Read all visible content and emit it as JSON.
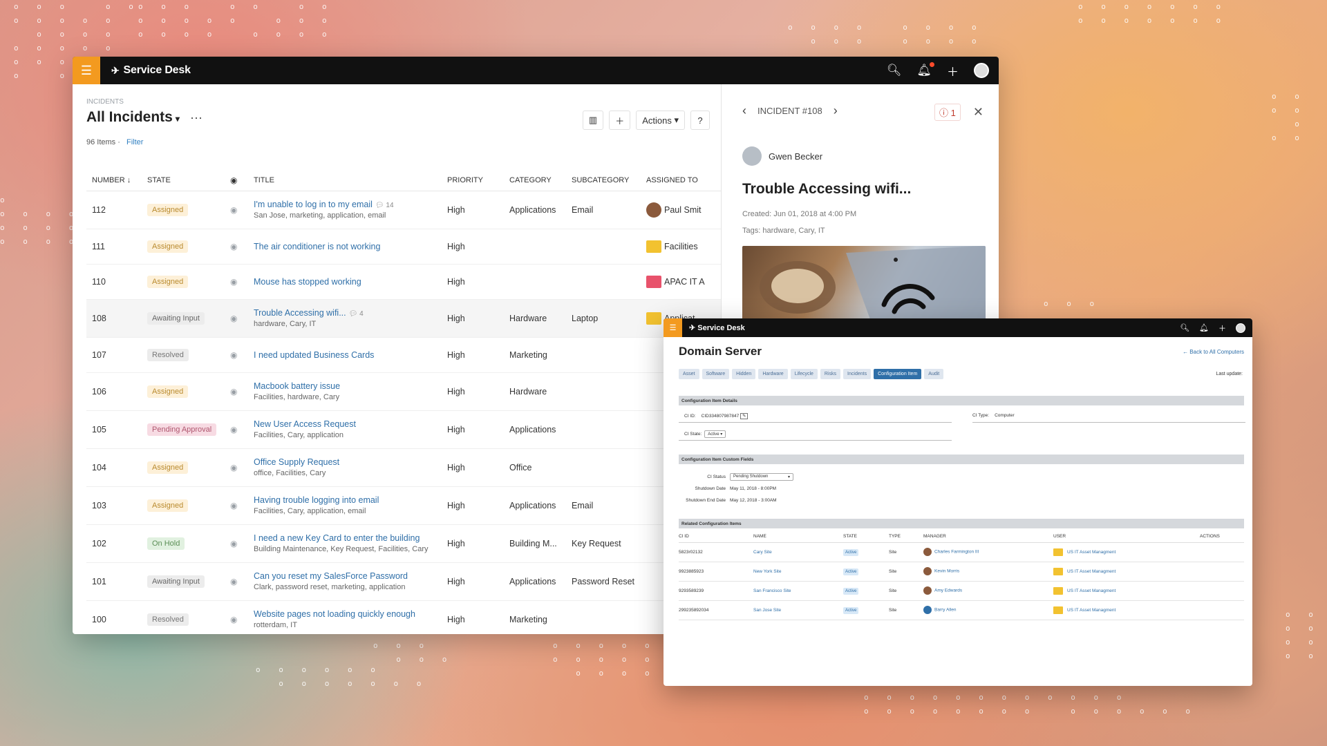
{
  "app": {
    "name": "Service Desk"
  },
  "list": {
    "breadcrumb": "INCIDENTS",
    "title": "All Incidents",
    "count": "96 Items",
    "filter": "Filter",
    "actions_label": "Actions",
    "help": "?",
    "columns": [
      "NUMBER",
      "STATE",
      "TITLE",
      "PRIORITY",
      "CATEGORY",
      "SUBCATEGORY",
      "ASSIGNED TO"
    ],
    "rows": [
      {
        "number": "112",
        "state": "Assigned",
        "title": "I'm unable to log in to my email",
        "comments": "14",
        "tags": "San Jose, marketing, application, email",
        "priority": "High",
        "category": "Applications",
        "subcategory": "Email",
        "assigned": "Paul Smit"
      },
      {
        "number": "111",
        "state": "Assigned",
        "title": "The air conditioner is not working",
        "priority": "High",
        "category": "",
        "subcategory": "",
        "assigned": "Facilities"
      },
      {
        "number": "110",
        "state": "Assigned",
        "title": "Mouse has stopped working",
        "priority": "High",
        "category": "",
        "subcategory": "",
        "assigned": "APAC IT A"
      },
      {
        "number": "108",
        "state": "Awaiting Input",
        "title": "Trouble Accessing wifi...",
        "comments": "4",
        "tags": "hardware, Cary, IT",
        "priority": "High",
        "category": "Hardware",
        "subcategory": "Laptop",
        "assigned": "Applicat"
      },
      {
        "number": "107",
        "state": "Resolved",
        "title": "I need updated Business Cards",
        "priority": "High",
        "category": "Marketing",
        "subcategory": "",
        "assigned": ""
      },
      {
        "number": "106",
        "state": "Assigned",
        "title": "Macbook battery issue",
        "tags": "Facilities, hardware, Cary",
        "priority": "High",
        "category": "Hardware",
        "subcategory": "",
        "assigned": ""
      },
      {
        "number": "105",
        "state": "Pending Approval",
        "title": "New User Access Request",
        "tags": "Facilities, Cary, application",
        "priority": "High",
        "category": "Applications",
        "subcategory": "",
        "assigned": ""
      },
      {
        "number": "104",
        "state": "Assigned",
        "title": "Office Supply Request",
        "tags": "office, Facilities, Cary",
        "priority": "High",
        "category": "Office",
        "subcategory": "",
        "assigned": ""
      },
      {
        "number": "103",
        "state": "Assigned",
        "title": "Having trouble logging into email",
        "tags": "Facilities, Cary, application, email",
        "priority": "High",
        "category": "Applications",
        "subcategory": "Email",
        "assigned": ""
      },
      {
        "number": "102",
        "state": "On Hold",
        "title": "I need a new Key Card to enter the building",
        "tags": "Building Maintenance, Key Request, Facilities, Cary",
        "priority": "High",
        "category": "Building M...",
        "subcategory": "Key Request",
        "assigned": ""
      },
      {
        "number": "101",
        "state": "Awaiting Input",
        "title": "Can you reset my SalesForce Password",
        "tags": "Clark, password reset, marketing, application",
        "priority": "High",
        "category": "Applications",
        "subcategory": "Password Reset",
        "assigned": ""
      },
      {
        "number": "100",
        "state": "Resolved",
        "title": "Website pages not loading quickly enough",
        "tags": "rotterdam, IT",
        "priority": "High",
        "category": "Marketing",
        "subcategory": "",
        "assigned": ""
      }
    ]
  },
  "detail": {
    "incident": "INCIDENT #108",
    "alert_count": "1",
    "person": "Gwen Becker",
    "title": "Trouble Accessing wifi...",
    "created": "Created: Jun 01, 2018 at 4:00 PM",
    "tags": "Tags: hardware, Cary, IT"
  },
  "domain": {
    "app_name": "Service Desk",
    "title": "Domain Server",
    "back": "← Back to All Computers",
    "last_update": "Last update:",
    "tabs": [
      "Asset",
      "Software",
      "Hidden",
      "Hardware",
      "Lifecycle",
      "Risks",
      "Incidents",
      "Configuration Item",
      "Audit"
    ],
    "sec_details": "Configuration Item Details",
    "ci_id_label": "CI ID:",
    "ci_id_value": "CID334807987847",
    "ci_type_label": "CI Type:",
    "ci_type_value": "Computer",
    "ci_state_label": "CI State:",
    "ci_state_value": "Active",
    "sec_custom": "Configuration Item Custom Fields",
    "ci_status_label": "CI Status",
    "ci_status_value": "Pending Shutdown",
    "shutdown_date_label": "Shutdown Date",
    "shutdown_date_value": "May 11, 2018 - 8:00PM",
    "shutdown_end_label": "Shutdown End Date",
    "shutdown_end_value": "May 12, 2018 - 3:00AM",
    "sec_related": "Related Configuration Items",
    "rel_columns": [
      "CI ID",
      "NAME",
      "STATE",
      "TYPE",
      "MANAGER",
      "USER",
      "ACTIONS"
    ],
    "rel_rows": [
      {
        "id": "5823r02132",
        "name": "Cary Site",
        "state": "Active",
        "type": "Site",
        "manager": "Charles Farmington III",
        "user": "US IT Asset Managment"
      },
      {
        "id": "9923885923",
        "name": "New York Site",
        "state": "Active",
        "type": "Site",
        "manager": "Kevin Morris",
        "user": "US IT Asset Managment"
      },
      {
        "id": "929358923​9",
        "name": "San Francisco Site",
        "state": "Active",
        "type": "Site",
        "manager": "Amy Edwards",
        "user": "US IT Asset Managment"
      },
      {
        "id": "299235892034",
        "name": "San Jose Site",
        "state": "Active",
        "type": "Site",
        "manager": "Barry Allen",
        "user": "US IT Asset Managment"
      }
    ]
  }
}
